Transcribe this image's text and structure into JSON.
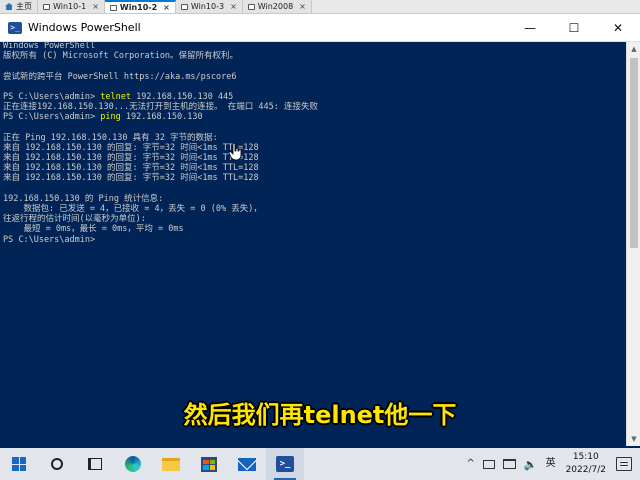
{
  "vm_tabs": [
    {
      "label": "主页",
      "icon": "home-icon",
      "active": false
    },
    {
      "label": "Win10-1",
      "icon": "vm-icon",
      "active": false
    },
    {
      "label": "Win10-2",
      "icon": "vm-icon",
      "active": true
    },
    {
      "label": "Win10-3",
      "icon": "vm-icon",
      "active": false
    },
    {
      "label": "Win2008",
      "icon": "vm-icon",
      "active": false
    }
  ],
  "window": {
    "title": "Windows PowerShell",
    "minimize": "—",
    "maximize": "☐",
    "close": "✕"
  },
  "console": {
    "lines": [
      {
        "text": "Windows PowerShell"
      },
      {
        "text": "版权所有 (C) Microsoft Corporation。保留所有权利。"
      },
      {
        "text": ""
      },
      {
        "text": "尝试新的跨平台 PowerShell https://aka.ms/pscore6"
      },
      {
        "text": ""
      },
      {
        "prompt": "PS C:\\Users\\admin> ",
        "cmd": "telnet",
        "args": " 192.168.150.130 445"
      },
      {
        "text": "正在连接192.168.150.130...无法打开到主机的连接。 在端口 445: 连接失败"
      },
      {
        "prompt": "PS C:\\Users\\admin> ",
        "cmd": "ping",
        "args": " 192.168.150.130"
      },
      {
        "text": ""
      },
      {
        "text": "正在 Ping 192.168.150.130 具有 32 字节的数据:"
      },
      {
        "text": "来自 192.168.150.130 的回复: 字节=32 时间<1ms TTL=128"
      },
      {
        "text": "来自 192.168.150.130 的回复: 字节=32 时间<1ms TTL=128"
      },
      {
        "text": "来自 192.168.150.130 的回复: 字节=32 时间<1ms TTL=128"
      },
      {
        "text": "来自 192.168.150.130 的回复: 字节=32 时间<1ms TTL=128"
      },
      {
        "text": ""
      },
      {
        "text": "192.168.150.130 的 Ping 统计信息:"
      },
      {
        "text": "    数据包: 已发送 = 4，已接收 = 4，丢失 = 0 (0% 丢失)，"
      },
      {
        "text": "往返行程的估计时间(以毫秒为单位):"
      },
      {
        "text": "    最短 = 0ms，最长 = 0ms，平均 = 0ms"
      },
      {
        "text": "PS C:\\Users\\admin>"
      }
    ]
  },
  "subtitle": "然后我们再telnet他一下",
  "taskbar": {
    "icons": [
      {
        "name": "start-button",
        "icon": "windows-logo-icon"
      },
      {
        "name": "search-button",
        "icon": "search-icon"
      },
      {
        "name": "task-view-button",
        "icon": "task-view-icon"
      },
      {
        "name": "edge-button",
        "icon": "edge-icon"
      },
      {
        "name": "file-explorer-button",
        "icon": "folder-icon"
      },
      {
        "name": "store-button",
        "icon": "store-icon"
      },
      {
        "name": "mail-button",
        "icon": "mail-icon"
      },
      {
        "name": "powershell-taskbar-button",
        "icon": "powershell-icon",
        "active": true
      }
    ],
    "tray": {
      "chevron": "^",
      "ime": "英",
      "time": "15:10",
      "date": "2022/7/2"
    }
  },
  "colors": {
    "console_bg": "#012456",
    "console_text": "#cccccc",
    "command_text": "#f2f200",
    "subtitle_text": "#ffe600",
    "accent": "#0078d7"
  }
}
